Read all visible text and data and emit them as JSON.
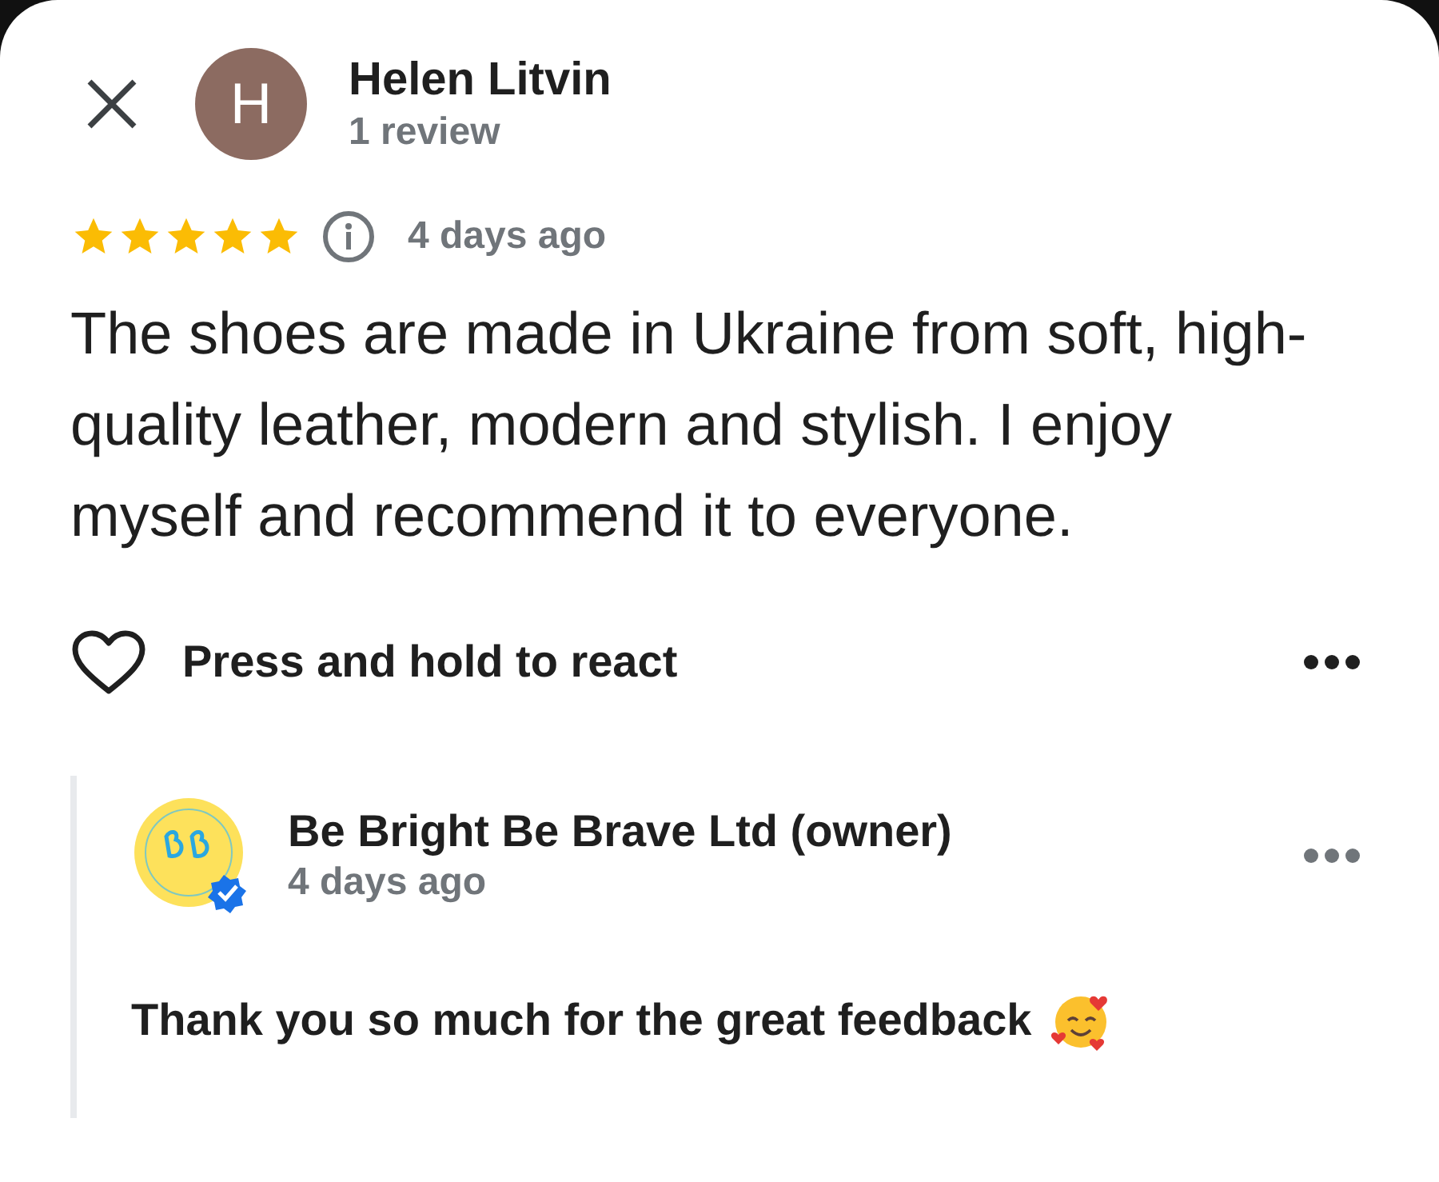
{
  "review": {
    "avatar_letter": "H",
    "author": "Helen Litvin",
    "author_meta": "1 review",
    "stars": 5,
    "time": "4 days ago",
    "text": "The shoes are made in Ukraine from soft, high-quality leather, modern and stylish. I enjoy myself and recommend it to everyone.",
    "react_label": "Press and hold to react"
  },
  "owner_reply": {
    "author": "Be Bright Be Brave Ltd (owner)",
    "time": "4 days ago",
    "text": "Thank you so much for the great feedback"
  }
}
